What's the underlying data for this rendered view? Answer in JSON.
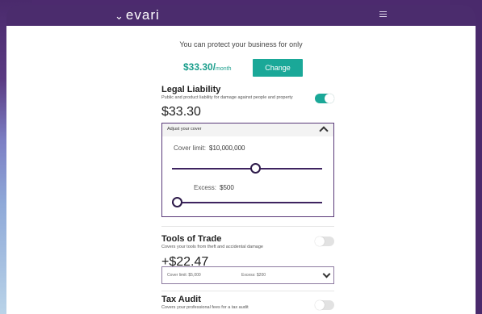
{
  "app": {
    "logo_text": "evari",
    "logo_mark": "⌄"
  },
  "header": {
    "headline": "You can protect your business for only"
  },
  "summary": {
    "price": "$33.30/",
    "per": "month",
    "change_label": "Change"
  },
  "legal_liability": {
    "title": "Legal Liability",
    "description": "Public and product liability for damage against people and property",
    "amount": "$33.30",
    "enabled": true,
    "adjust": {
      "heading": "Adjust your cover",
      "cover_limit_label": "Cover limit:",
      "cover_limit_value": "$10,000,000",
      "cover_limit_level": 0.5,
      "excess_label": "Excess:",
      "excess_value": "$500",
      "excess_level": 0.0
    }
  },
  "tools_of_trade": {
    "title": "Tools of Trade",
    "description": "Covers your tools from theft and accidental damage",
    "amount": "+$22.47",
    "enabled": false,
    "cover_limit_text": "Cover limit: $5,000",
    "excess_text": "Excess: $200"
  },
  "tax_audit": {
    "title": "Tax Audit",
    "description": "Covers your professional fees for a tax audit",
    "enabled": false
  },
  "colors": {
    "brand_purple": "#4b2c6d",
    "accent_teal": "#1aa898"
  }
}
